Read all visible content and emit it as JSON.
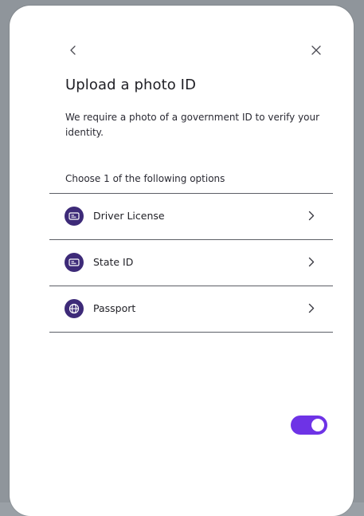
{
  "dialog": {
    "title": "Upload a photo ID",
    "description": "We require a photo of a government ID to verify your identity.",
    "choose_prompt": "Choose 1 of the following options"
  },
  "header": {
    "back_icon": "chevron-left-icon",
    "close_icon": "close-icon"
  },
  "options": [
    {
      "label": "Driver License",
      "icon": "id-card-icon"
    },
    {
      "label": "State ID",
      "icon": "id-card-icon"
    },
    {
      "label": "Passport",
      "icon": "globe-icon"
    }
  ],
  "toggle": {
    "state": "on"
  },
  "colors": {
    "accent": "#6e33e6",
    "badge": "#3d2a78",
    "divider": "#5c5f66",
    "backdrop": "#8f959b"
  }
}
